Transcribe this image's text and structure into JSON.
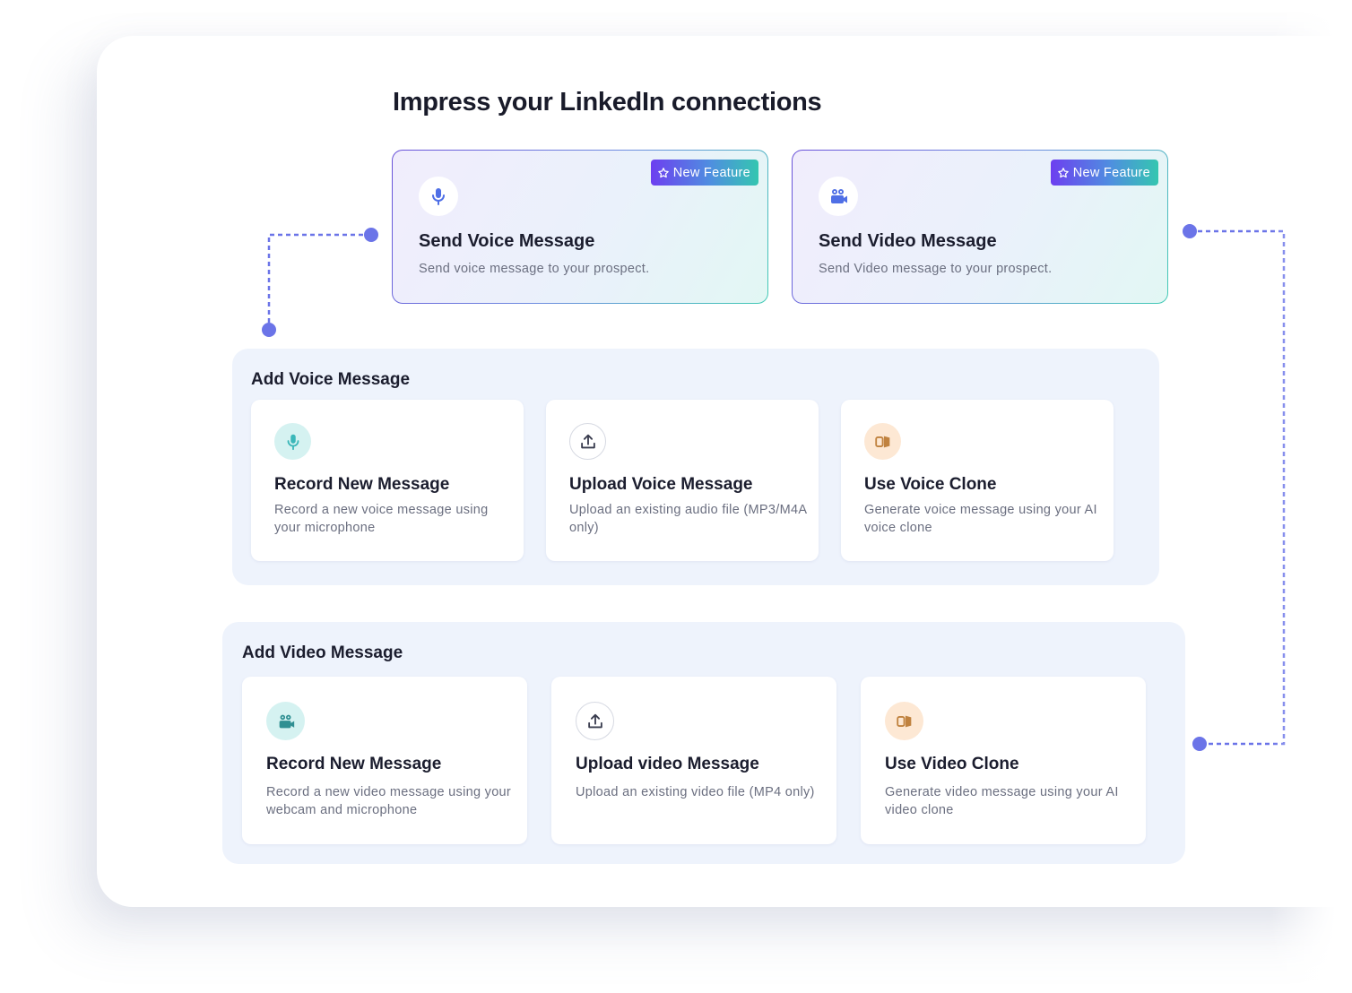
{
  "page": {
    "title": "Impress your LinkedIn connections"
  },
  "feature_cards": [
    {
      "badge": "New Feature",
      "icon": "microphone-icon",
      "title": "Send Voice Message",
      "description": "Send voice message to your prospect."
    },
    {
      "badge": "New Feature",
      "icon": "video-camera-icon",
      "title": "Send Video Message",
      "description": "Send Video message to your prospect."
    }
  ],
  "voice_panel": {
    "title": "Add Voice Message",
    "options": [
      {
        "icon": "microphone-icon",
        "title": "Record New Message",
        "description": "Record a new voice message using your microphone"
      },
      {
        "icon": "upload-icon",
        "title": "Upload Voice Message",
        "description": "Upload an existing audio file (MP3/M4A only)"
      },
      {
        "icon": "clone-icon",
        "title": "Use Voice Clone",
        "description": "Generate voice message using your AI voice clone"
      }
    ]
  },
  "video_panel": {
    "title": "Add Video Message",
    "options": [
      {
        "icon": "video-camera-icon",
        "title": "Record New Message",
        "description": "Record a new video message using your webcam and microphone"
      },
      {
        "icon": "upload-icon",
        "title": "Upload video Message",
        "description": "Upload an existing video file (MP4 only)"
      },
      {
        "icon": "clone-icon",
        "title": "Use Video Clone",
        "description": "Generate video message using your AI video clone"
      }
    ]
  },
  "colors": {
    "accent": "#6b74e8",
    "badge_start": "#6d3ff0",
    "badge_end": "#34c6b0",
    "panel_bg": "#eef3fc",
    "icon_blue": "#4f6fe6",
    "icon_teal": "#3bb7b9",
    "icon_clone": "#c0823f"
  }
}
